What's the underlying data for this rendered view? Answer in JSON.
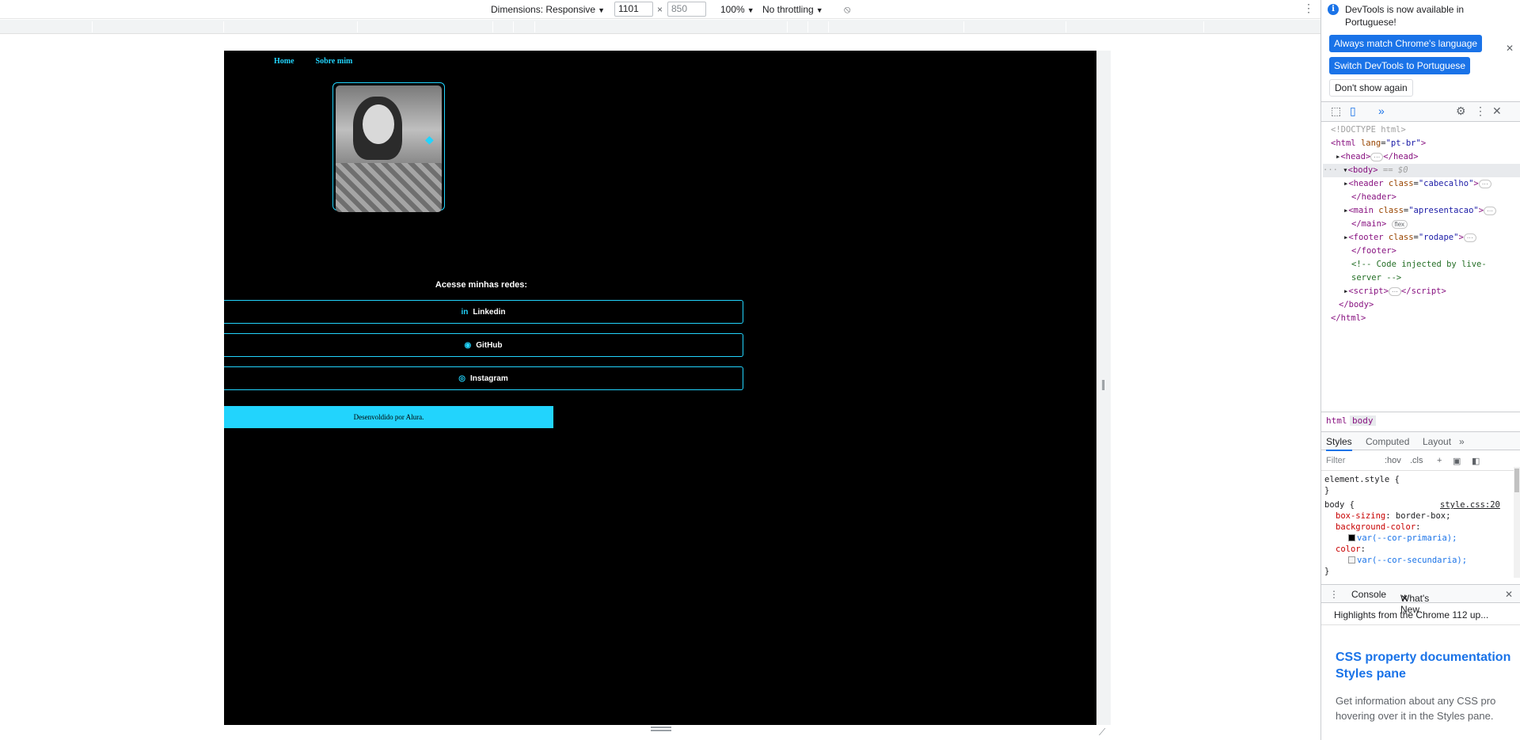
{
  "device_toolbar": {
    "dimensions_label": "Dimensions: Responsive",
    "width_value": "1101",
    "times": "×",
    "height_placeholder": "850",
    "zoom": "100%",
    "throttling": "No throttling"
  },
  "site": {
    "nav": [
      "Home",
      "Sobre mim"
    ],
    "social_title": "Acesse minhas redes:",
    "links": [
      {
        "icon": "in",
        "label": "Linkedin"
      },
      {
        "icon": "◉",
        "label": "GitHub"
      },
      {
        "icon": "◎",
        "label": "Instagram"
      }
    ],
    "footer": "Desenvoldido por Alura."
  },
  "devtools": {
    "info_text": "DevTools is now available in Portuguese!",
    "btn_match": "Always match Chrome's language",
    "btn_switch": "Switch DevTools to Portuguese",
    "btn_dismiss": "Don't show again",
    "dom": {
      "doctype": "<!DOCTYPE html>",
      "html_open": "html",
      "lang_attr": "lang",
      "lang_val": "\"pt-br\"",
      "head": "head",
      "body": "body",
      "body_ref": "== $0",
      "header_tag": "header",
      "header_class": "\"cabecalho\"",
      "main_tag": "main",
      "main_class": "\"apresentacao\"",
      "main_badge": "flex",
      "footer_tag": "footer",
      "footer_class": "\"rodape\"",
      "comment": "<!-- Code injected by live-",
      "comment2": "server -->",
      "script_tag": "script",
      "class_attr": "class"
    },
    "breadcrumb": [
      "html",
      "body"
    ],
    "styles_tabs": [
      "Styles",
      "Computed",
      "Layout"
    ],
    "filter_placeholder": "Filter",
    "hov": ":hov",
    "cls": ".cls",
    "css": {
      "element_style": "element.style {",
      "close": "}",
      "body_selector": "body {",
      "source": "style.css:20",
      "p1_name": "box-sizing",
      "p1_val": "border-box;",
      "p2_name": "background-color",
      "p2_val": "var(--cor-primaria);",
      "p3_name": "color",
      "p3_val": "var(--cor-secundaria);"
    },
    "drawer_tabs": [
      "Console",
      "What's New"
    ],
    "whats_new_header": "Highlights from the Chrome 112 up...",
    "whats_new_title_1": "CSS property documentation",
    "whats_new_title_2": "Styles pane",
    "whats_new_body_1": "Get information about any CSS pro",
    "whats_new_body_2": "hovering over it in the Styles pane."
  },
  "colors": {
    "accent": "#22d4fd",
    "page_bg": "#000000",
    "devtools_blue": "#1a73e8"
  }
}
